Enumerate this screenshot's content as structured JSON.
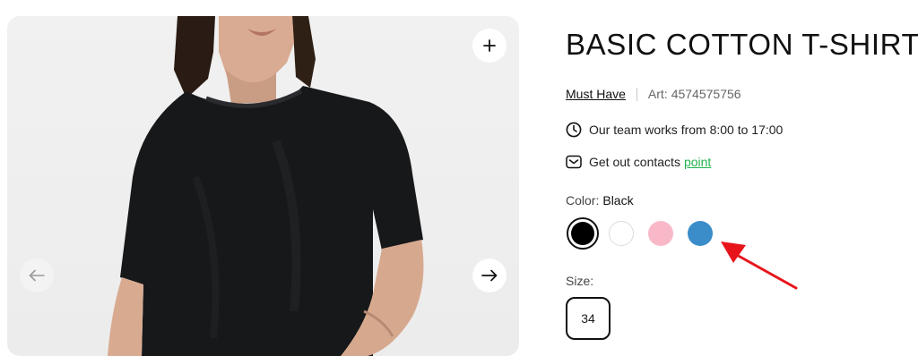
{
  "gallery": {
    "zoom_icon": "plus-icon",
    "prev_icon": "arrow-left-icon",
    "next_icon": "arrow-right-icon"
  },
  "product": {
    "title": "BASIC COTTON T-SHIRT",
    "collection_link": "Must Have",
    "article_label": "Art:",
    "article_number": "4574575756"
  },
  "info": {
    "hours_text": "Our team works from 8:00 to 17:00",
    "hours_icon": "clock-icon",
    "contacts_text": "Get out contacts",
    "contacts_link": "point",
    "contacts_icon": "mail-icon"
  },
  "color": {
    "label": "Color:",
    "selected": "Black",
    "swatches": [
      {
        "name": "black",
        "hex": "#000000",
        "selected": true
      },
      {
        "name": "white",
        "hex": "#ffffff",
        "selected": false
      },
      {
        "name": "pink",
        "hex": "#f9b8c8",
        "selected": false
      },
      {
        "name": "blue",
        "hex": "#3a8dc9",
        "selected": false
      }
    ]
  },
  "size": {
    "label": "Size:",
    "options": [
      "34"
    ]
  },
  "colors": {
    "accent_green": "#22b34e",
    "annotation_red": "#e8141b"
  }
}
